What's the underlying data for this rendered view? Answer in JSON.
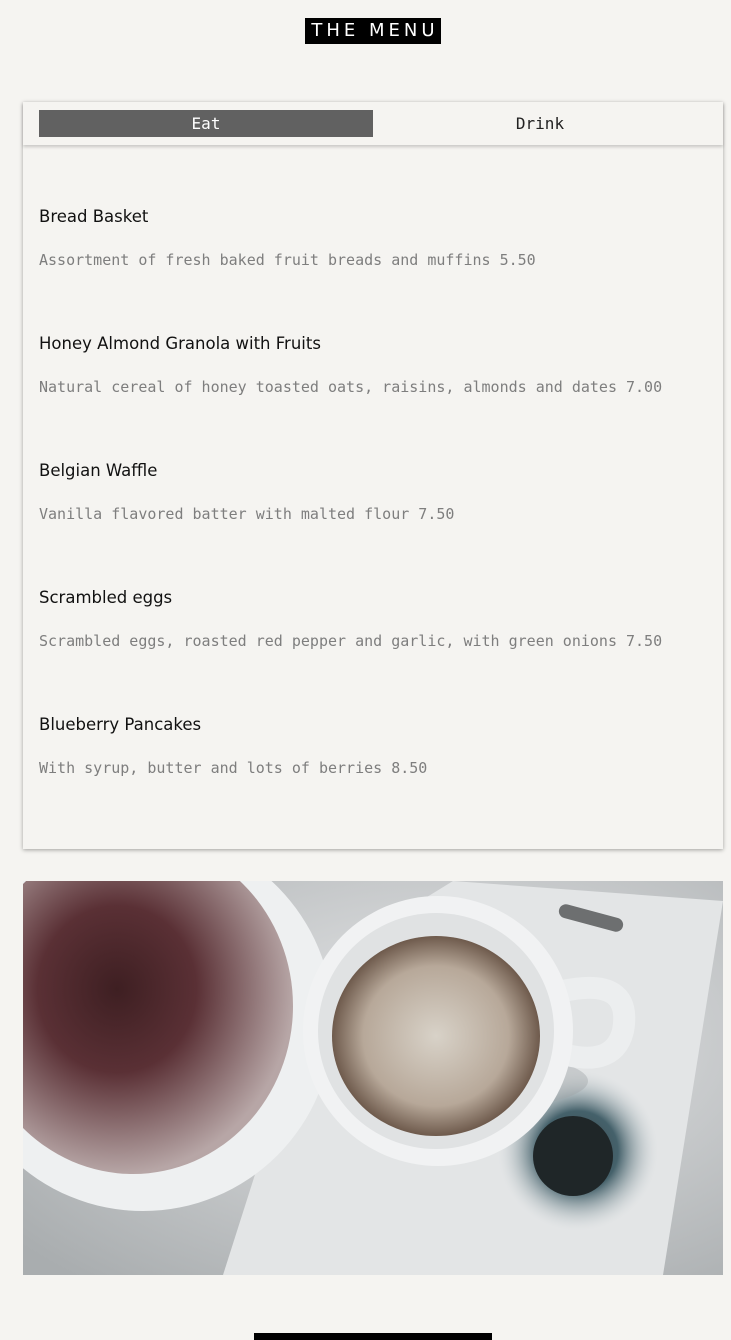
{
  "header": {
    "title": "THE MENU"
  },
  "tabs": [
    {
      "label": "Eat",
      "active": true
    },
    {
      "label": "Drink",
      "active": false
    }
  ],
  "items": [
    {
      "name": "Bread Basket",
      "description": "Assortment of fresh baked fruit breads and muffins 5.50"
    },
    {
      "name": "Honey Almond Granola with Fruits",
      "description": "Natural cereal of honey toasted oats, raisins, almonds and dates 7.00"
    },
    {
      "name": "Belgian Waffle",
      "description": "Vanilla flavored batter with malted flour 7.50"
    },
    {
      "name": "Scrambled eggs",
      "description": "Scrambled eggs, roasted red pepper and garlic, with green onions 7.50"
    },
    {
      "name": "Blueberry Pancakes",
      "description": "With syrup, butter and lots of berries 8.50"
    }
  ],
  "colors": {
    "active_tab": "#616161",
    "background": "#f5f4f1",
    "title_bg": "#000000"
  }
}
